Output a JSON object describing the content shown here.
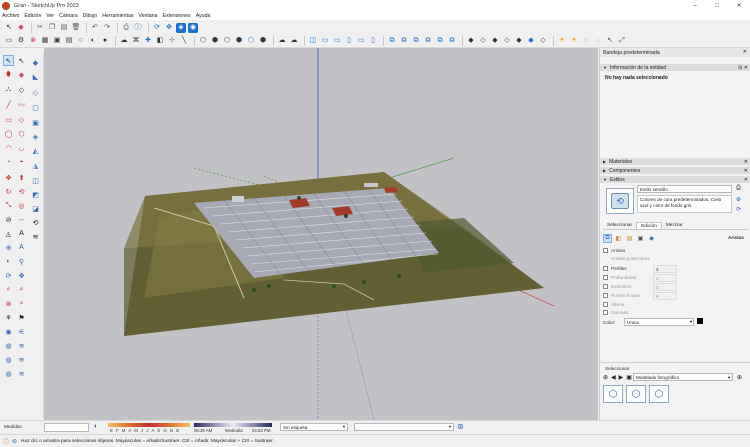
{
  "window": {
    "title": "Gran - SketchUp Pro 2023",
    "minimize": "–",
    "maximize": "□",
    "close": "✕"
  },
  "menu": [
    "Archivo",
    "Edición",
    "Ver",
    "Cámara",
    "Dibujo",
    "Herramientas",
    "Ventana",
    "Extensiones",
    "Ayuda"
  ],
  "viewport": {
    "description_hidden": ""
  },
  "tray": {
    "title": "Bandeja predeterminada",
    "entity_info": {
      "header": "Información de la entidad",
      "empty_text": "No hay nada seleccionado"
    },
    "materials_header": "Materiales",
    "components_header": "Componentes",
    "styles": {
      "header": "Estilos",
      "style_name": "Estilo sencillo",
      "style_desc": "Colores de cara predeterminados. Cielo azul y color de fondo gris.",
      "tabs": [
        "Seleccionar",
        "Edición",
        "Mezclar"
      ],
      "active_tab": "Edición",
      "section_title": "Aristas",
      "edges_label": "Aristas",
      "back_edges_label": "Aristas posteriores",
      "profiles_label": "Perfiles",
      "profiles_val": "2",
      "depth_label": "Profundidad",
      "depth_val": "4",
      "extension_label": "Extensión",
      "extension_val": "3",
      "endpoints_label": "Puntos finales",
      "endpoints_val": "6",
      "jitter_label": "Alterar",
      "halo_label": "Guiones",
      "color_label": "Color:",
      "color_value": "Única",
      "select_header": "Seleccionar",
      "collection": "Modelado fotográfico"
    }
  },
  "statusbar": {
    "measure_label": "Medidas",
    "months": "E F M A M J J A S O N D",
    "time1": "05:39 AM",
    "mid_label": "Mediodía",
    "time2": "04:52 PM",
    "tag": "Sin etiqueta",
    "hint": "Haz clic o arrastra para seleccionar objetos. Mayúsculas = Añadir/Sustraer. Ctrl = Añadir. Mayúsculas + Ctrl = Sustraer."
  },
  "colors": {
    "accent_blue": "#1a6fd1",
    "axis_red": "#c03030",
    "axis_green": "#2e8b2e",
    "axis_blue": "#3050c8",
    "terrain": "#6e6a3a"
  }
}
